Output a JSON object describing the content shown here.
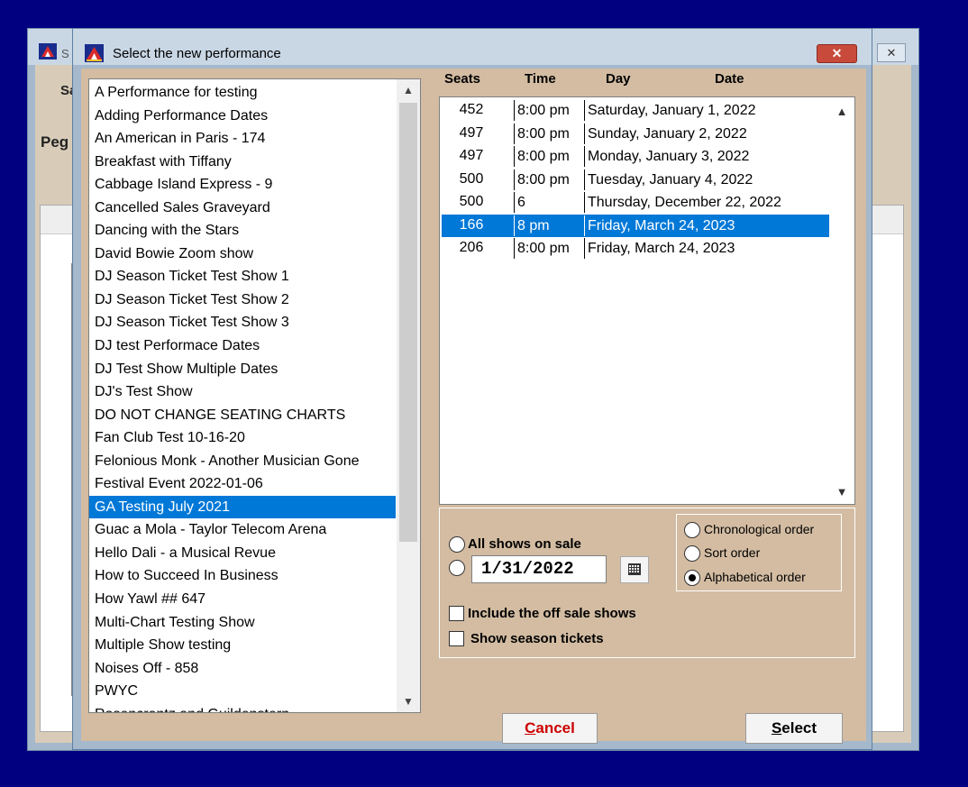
{
  "background_window": {
    "title_fragment": "S",
    "close_glyph": "✕",
    "label_top": "Sa",
    "label_mid": "Peg"
  },
  "dialog": {
    "title": "Select the new performance",
    "close_glyph": "✕"
  },
  "show_list": {
    "items": [
      "A Performance for testing",
      "Adding Performance Dates",
      "An American in Paris - 174",
      "Breakfast with Tiffany",
      "Cabbage Island Express - 9",
      "Cancelled Sales Graveyard",
      "Dancing with the Stars",
      "David Bowie Zoom show",
      "DJ Season Ticket Test Show 1",
      "DJ Season Ticket Test Show 2",
      "DJ Season Ticket Test Show 3",
      "DJ test Performace Dates",
      "DJ Test Show Multiple Dates",
      "DJ's Test Show",
      "DO NOT CHANGE SEATING CHARTS",
      "Fan Club Test 10-16-20",
      "Felonious Monk - Another Musician Gone",
      "Festival Event 2022-01-06",
      "GA Testing July 2021",
      "Guac a Mola - Taylor Telecom Arena",
      "Hello Dali - a Musical Revue",
      "How to Succeed In Business",
      "How Yawl ## 647",
      "Multi-Chart Testing Show",
      "Multiple Show testing",
      "Noises Off - 858",
      "PWYC",
      "Rosencrantz and Guildenstern"
    ],
    "selected_index": 18,
    "scroll_up_glyph": "▲",
    "scroll_down_glyph": "▼"
  },
  "performances": {
    "headers": {
      "seats": "Seats",
      "time": "Time",
      "day": "Day",
      "date": "Date"
    },
    "rows": [
      {
        "seats": "452",
        "time": "8:00 pm",
        "day": "Saturday, January 1, 2022"
      },
      {
        "seats": "497",
        "time": "8:00 pm",
        "day": "Sunday, January 2, 2022"
      },
      {
        "seats": "497",
        "time": "8:00 pm",
        "day": "Monday, January 3, 2022"
      },
      {
        "seats": "500",
        "time": "8:00 pm",
        "day": "Tuesday, January 4, 2022"
      },
      {
        "seats": "500",
        "time": "6",
        "day": "Thursday, December 22, 2022"
      },
      {
        "seats": "166",
        "time": "8 pm",
        "day": "Friday, March 24, 2023"
      },
      {
        "seats": "206",
        "time": "8:00 pm",
        "day": "Friday, March 24, 2023"
      }
    ],
    "selected_index": 5,
    "scroll_up_glyph": "▲",
    "scroll_down_glyph": "▼"
  },
  "options": {
    "all_shows_label": "All shows on sale",
    "all_shows_checked": false,
    "date_checked": false,
    "date_value": "1/31/2022",
    "include_off_sale_label": "Include the off sale shows",
    "include_off_sale_checked": false,
    "season_tickets_label": "Show season tickets",
    "season_tickets_checked": false,
    "sort": {
      "chronological_label": "Chronological order",
      "sort_order_label": "Sort order",
      "alphabetical_label": "Alphabetical order",
      "selected": "alphabetical"
    }
  },
  "buttons": {
    "cancel_first": "C",
    "cancel_rest": "ancel",
    "select_first": "S",
    "select_rest": "elect"
  },
  "colors": {
    "desktop": "#000080",
    "selection": "#0078d7",
    "dialog_body": "#d3bca2",
    "cancel_text": "#cc0000"
  }
}
